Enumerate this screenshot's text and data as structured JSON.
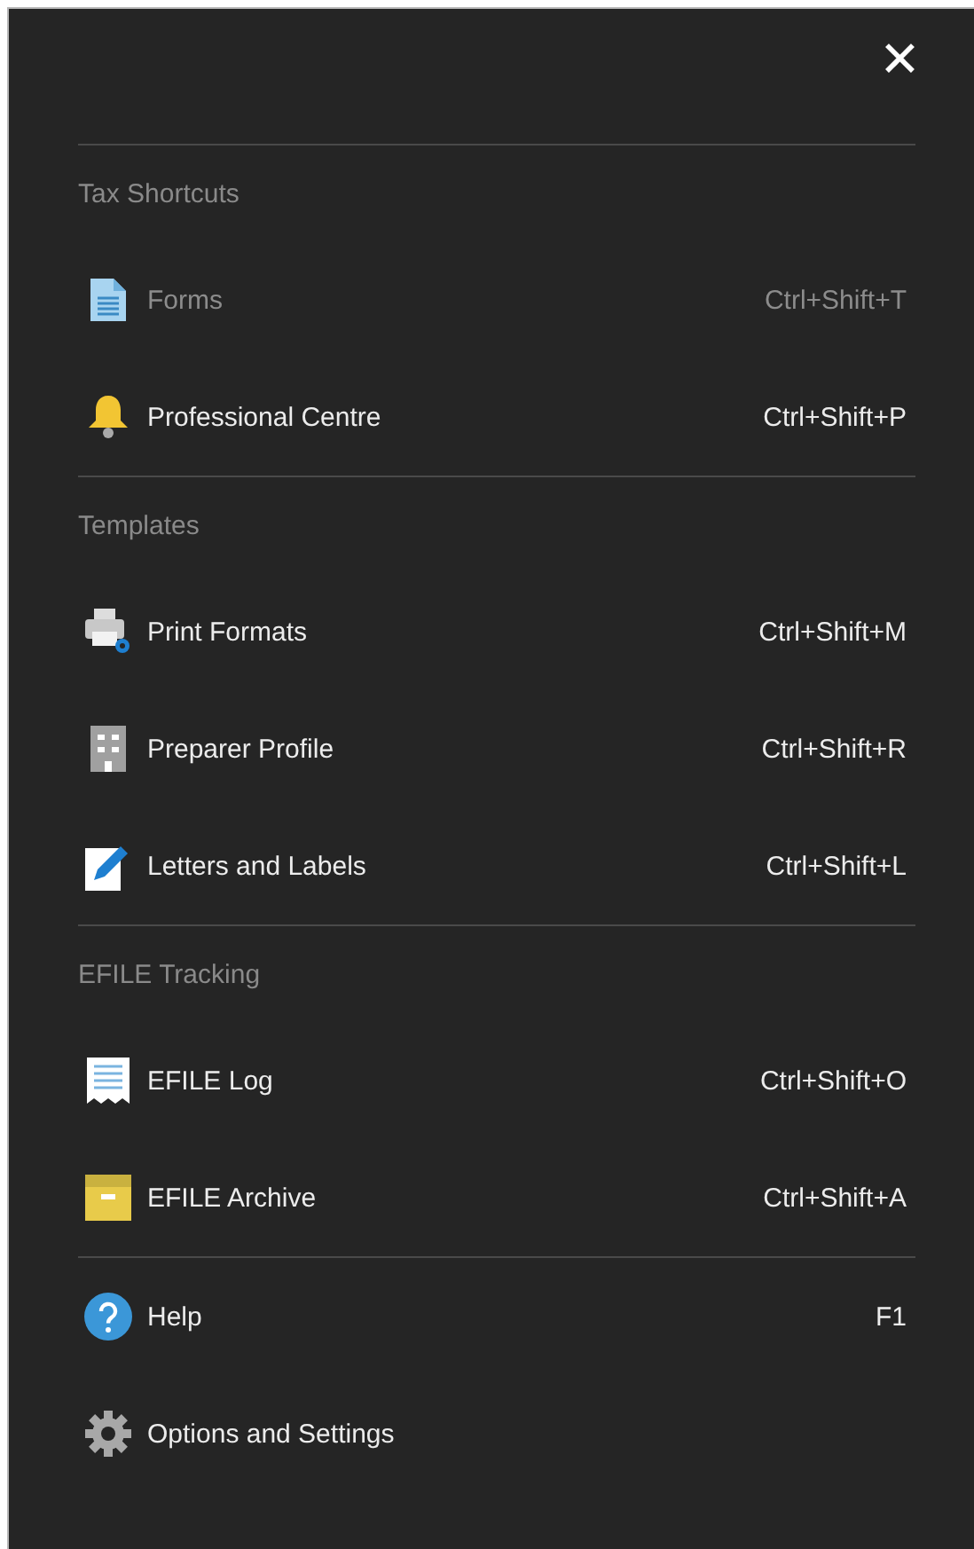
{
  "close_button": {
    "label": "✕"
  },
  "sections": [
    {
      "title": "Tax Shortcuts",
      "items": [
        {
          "kind": "document",
          "label": "Forms",
          "shortcut": "Ctrl+Shift+T",
          "disabled": true
        },
        {
          "kind": "bell",
          "label": "Professional Centre",
          "shortcut": "Ctrl+Shift+P",
          "disabled": false
        }
      ]
    },
    {
      "title": "Templates",
      "items": [
        {
          "kind": "printer",
          "label": "Print Formats",
          "shortcut": "Ctrl+Shift+M",
          "disabled": false
        },
        {
          "kind": "building",
          "label": "Preparer Profile",
          "shortcut": "Ctrl+Shift+R",
          "disabled": false
        },
        {
          "kind": "pencil",
          "label": "Letters and Labels",
          "shortcut": "Ctrl+Shift+L",
          "disabled": false
        }
      ]
    },
    {
      "title": "EFILE Tracking",
      "items": [
        {
          "kind": "receipt",
          "label": "EFILE Log",
          "shortcut": "Ctrl+Shift+O",
          "disabled": false
        },
        {
          "kind": "archive",
          "label": "EFILE Archive",
          "shortcut": "Ctrl+Shift+A",
          "disabled": false
        }
      ]
    },
    {
      "items": [
        {
          "kind": "help",
          "label": "Help",
          "shortcut": "F1",
          "disabled": false
        },
        {
          "kind": "gear",
          "label": "Options and Settings",
          "disabled": false
        }
      ]
    }
  ]
}
